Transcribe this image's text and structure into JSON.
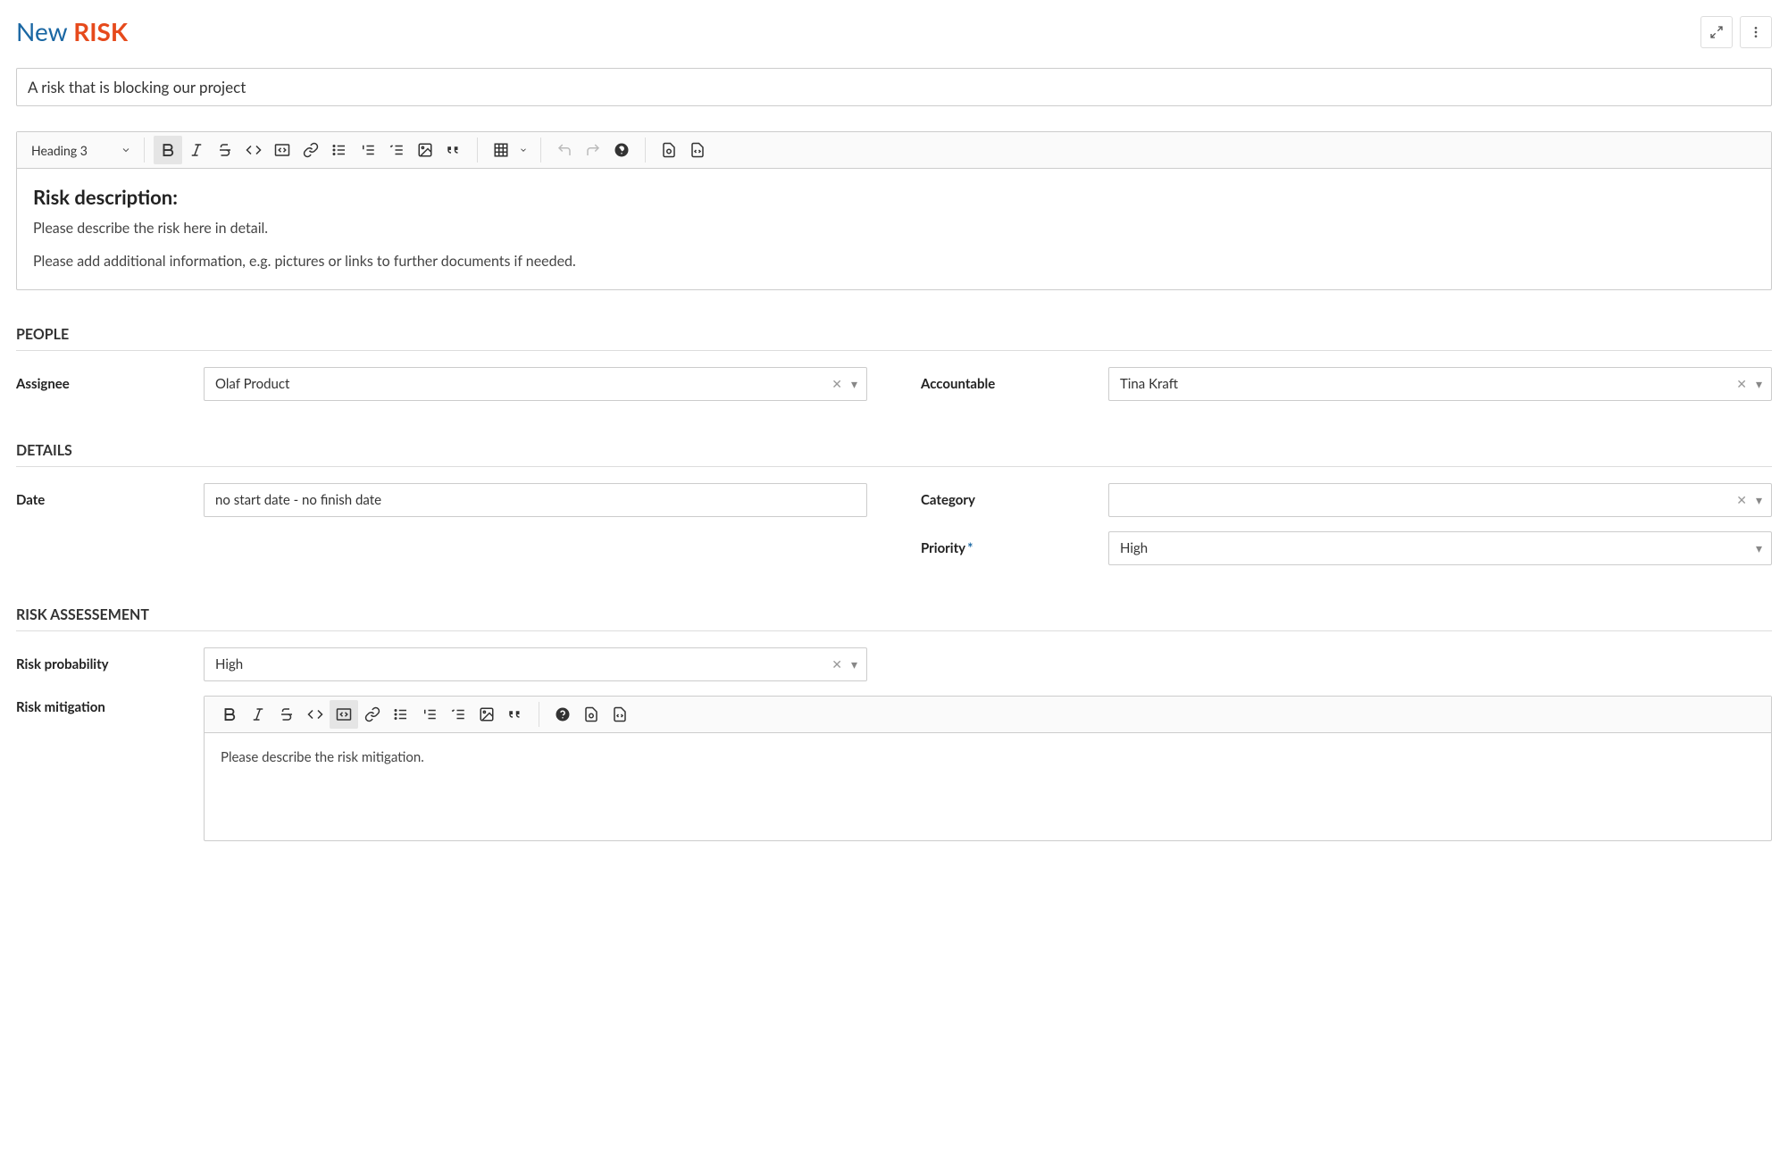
{
  "header": {
    "new_label": "New",
    "type_label": "RISK"
  },
  "subject": {
    "value": "A risk that is blocking our project"
  },
  "main_editor": {
    "heading_selected": "Heading 3",
    "body_heading": "Risk description:",
    "body_p1": "Please describe the risk here in detail.",
    "body_p2": "Please add additional information, e.g. pictures or links to further documents if needed."
  },
  "sections": {
    "people": "PEOPLE",
    "details": "DETAILS",
    "risk_assessment": "RISK ASSESSEMENT"
  },
  "fields": {
    "assignee": {
      "label": "Assignee",
      "value": "Olaf Product"
    },
    "accountable": {
      "label": "Accountable",
      "value": "Tina Kraft"
    },
    "date": {
      "label": "Date",
      "value": "no start date - no finish date"
    },
    "category": {
      "label": "Category",
      "value": ""
    },
    "priority": {
      "label": "Priority",
      "value": "High",
      "required": true
    },
    "risk_probability": {
      "label": "Risk probability",
      "value": "High"
    },
    "risk_mitigation": {
      "label": "Risk mitigation",
      "body": "Please describe the risk mitigation."
    }
  }
}
